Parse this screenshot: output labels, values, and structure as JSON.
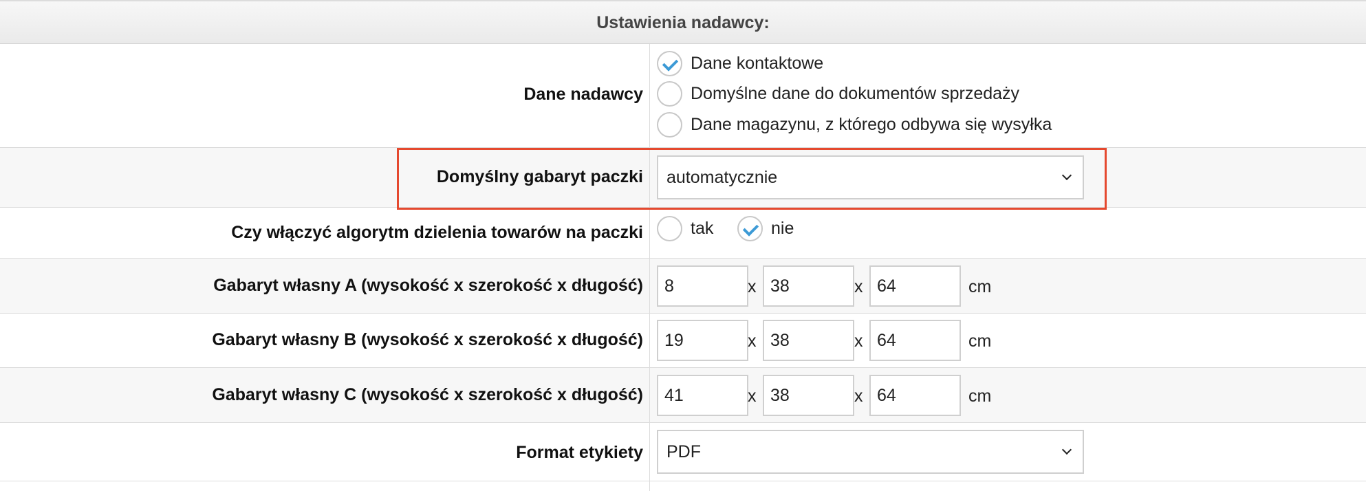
{
  "header": {
    "title": "Ustawienia nadawcy:"
  },
  "sender_data": {
    "label": "Dane nadawcy",
    "options": [
      {
        "label": "Dane kontaktowe",
        "checked": true
      },
      {
        "label": "Domyślne dane do dokumentów sprzedaży",
        "checked": false
      },
      {
        "label": "Dane magazynu, z którego odbywa się wysyłka",
        "checked": false
      }
    ]
  },
  "default_size": {
    "label": "Domyślny gabaryt paczki",
    "value": "automatycznie"
  },
  "split_algorithm": {
    "label": "Czy włączyć algorytm dzielenia towarów na paczki",
    "options": [
      {
        "label": "tak",
        "checked": false
      },
      {
        "label": "nie",
        "checked": true
      }
    ]
  },
  "custom_sizes": [
    {
      "label": "Gabaryt własny A (wysokość x szerokość x długość)",
      "values": [
        "8",
        "38",
        "64"
      ],
      "separator": "x",
      "unit": "cm"
    },
    {
      "label": "Gabaryt własny B (wysokość x szerokość x długość)",
      "values": [
        "19",
        "38",
        "64"
      ],
      "separator": "x",
      "unit": "cm"
    },
    {
      "label": "Gabaryt własny C (wysokość x szerokość x długość)",
      "values": [
        "41",
        "38",
        "64"
      ],
      "separator": "x",
      "unit": "cm"
    }
  ],
  "label_format": {
    "label": "Format etykiety",
    "value": "PDF"
  },
  "colors": {
    "highlight": "#e5492f",
    "check": "#3c9ad6"
  }
}
